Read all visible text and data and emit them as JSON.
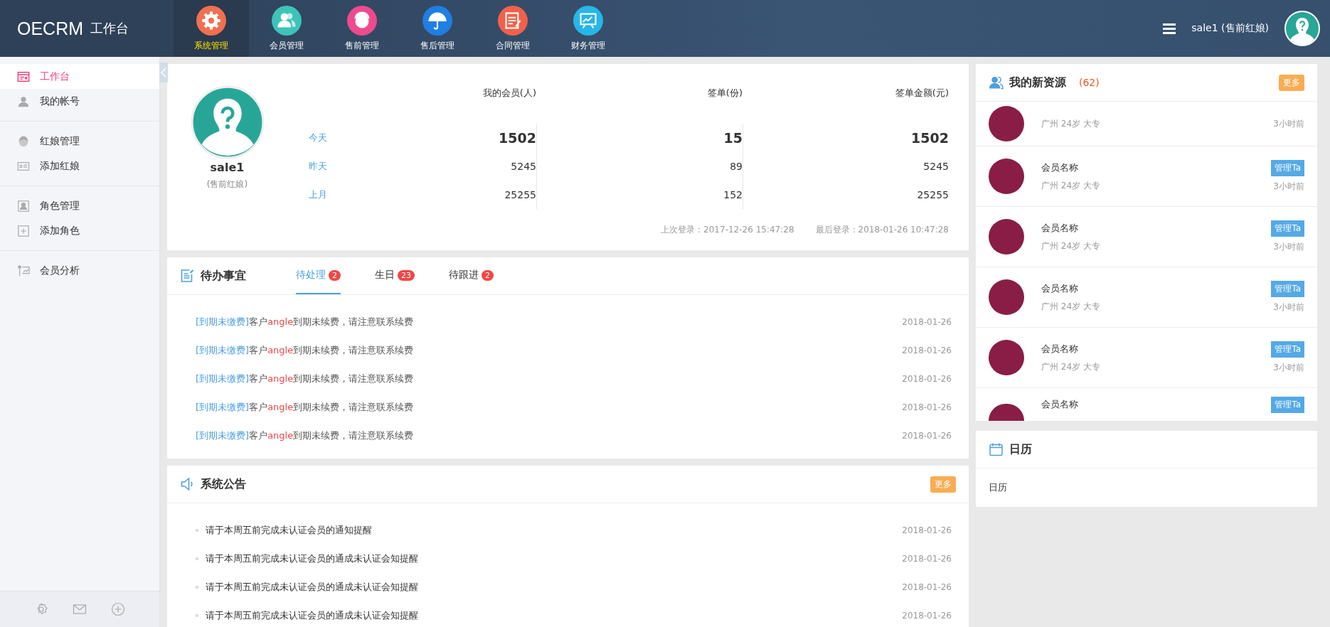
{
  "header": {
    "logo": "OECRM",
    "logo_sub": "工作台",
    "nav": [
      {
        "label": "系统管理",
        "selected": true,
        "color": "#f26f50"
      },
      {
        "label": "会员管理",
        "selected": false,
        "color": "#3ec3b9"
      },
      {
        "label": "售前管理",
        "selected": false,
        "color": "#ee4a8e"
      },
      {
        "label": "售后管理",
        "selected": false,
        "color": "#1f7fe2"
      },
      {
        "label": "合同管理",
        "selected": false,
        "color": "#f1614a"
      },
      {
        "label": "财务管理",
        "selected": false,
        "color": "#27b6e8"
      }
    ],
    "user": "sale1 (售前红娘)"
  },
  "sidebar": {
    "groups": [
      [
        {
          "label": "工作台",
          "selected": true
        },
        {
          "label": "我的帐号",
          "selected": false
        }
      ],
      [
        {
          "label": "红娘管理",
          "selected": false
        },
        {
          "label": "添加红娘",
          "selected": false
        }
      ],
      [
        {
          "label": "角色管理",
          "selected": false
        },
        {
          "label": "添加角色",
          "selected": false
        }
      ],
      [
        {
          "label": "会员分析",
          "selected": false
        }
      ]
    ]
  },
  "profile": {
    "name": "sale1",
    "role": "(售前红娘)",
    "columns": [
      "我的会员(人)",
      "签单(份)",
      "签单金额(元)"
    ],
    "rows": [
      {
        "label": "今天",
        "values": [
          "1502",
          "15",
          "1502"
        ],
        "emphasis": true
      },
      {
        "label": "昨天",
        "values": [
          "5245",
          "89",
          "5245"
        ],
        "emphasis": false
      },
      {
        "label": "上月",
        "values": [
          "25255",
          "152",
          "25255"
        ],
        "emphasis": false
      }
    ],
    "last_login": "上次登录：2017-12-26 15:47:28",
    "latest_login": "最后登录：2018-01-26 10:47:28"
  },
  "todo": {
    "title": "待办事宜",
    "tabs": [
      {
        "label": "待处理",
        "count": "2",
        "selected": true
      },
      {
        "label": "生日",
        "count": "23",
        "selected": false
      },
      {
        "label": "待跟进",
        "count": "2",
        "selected": false
      }
    ],
    "items": [
      {
        "tag": "[到期未缴费]",
        "prefix": "客户",
        "customer": "angle",
        "suffix": "到期未续费，请注意联系续费",
        "date": "2018-01-26"
      },
      {
        "tag": "[到期未缴费]",
        "prefix": "客户",
        "customer": "angle",
        "suffix": "到期未续费，请注意联系续费",
        "date": "2018-01-26"
      },
      {
        "tag": "[到期未缴费]",
        "prefix": "客户",
        "customer": "angle",
        "suffix": "到期未续费，请注意联系续费",
        "date": "2018-01-26"
      },
      {
        "tag": "[到期未缴费]",
        "prefix": "客户",
        "customer": "angle",
        "suffix": "到期未续费，请注意联系续费",
        "date": "2018-01-26"
      },
      {
        "tag": "[到期未缴费]",
        "prefix": "客户",
        "customer": "angle",
        "suffix": "到期未续费，请注意联系续费",
        "date": "2018-01-26"
      }
    ]
  },
  "notices": {
    "title": "系统公告",
    "more": "更多",
    "items": [
      {
        "text": "请于本周五前完成未认证会员的通知提醒",
        "date": "2018-01-26"
      },
      {
        "text": "请于本周五前完成未认证会员的通成未认证会知提醒",
        "date": "2018-01-26"
      },
      {
        "text": "请于本周五前完成未认证会员的通成未认证会知提醒",
        "date": "2018-01-26"
      },
      {
        "text": "请于本周五前完成未认证会员的通成未认证会知提醒",
        "date": "2018-01-26"
      }
    ]
  },
  "resources": {
    "title": "我的新资源",
    "count": "(62)",
    "more": "更多",
    "items": [
      {
        "info": "广州 24岁 大专",
        "time": "3小时前"
      },
      {
        "name": "会员名称",
        "info": "广州 24岁 大专",
        "button": "管理Ta",
        "time": "3小时前"
      },
      {
        "name": "会员名称",
        "info": "广州 24岁 大专",
        "button": "管理Ta",
        "time": "3小时前"
      },
      {
        "name": "会员名称",
        "info": "广州 24岁 大专",
        "button": "管理Ta",
        "time": "3小时前"
      },
      {
        "name": "会员名称",
        "info": "广州 24岁 大专",
        "button": "管理Ta",
        "time": "3小时前"
      },
      {
        "name": "会员名称",
        "button": "管理Ta"
      }
    ]
  },
  "calendar": {
    "title": "日历",
    "body": "日历"
  }
}
